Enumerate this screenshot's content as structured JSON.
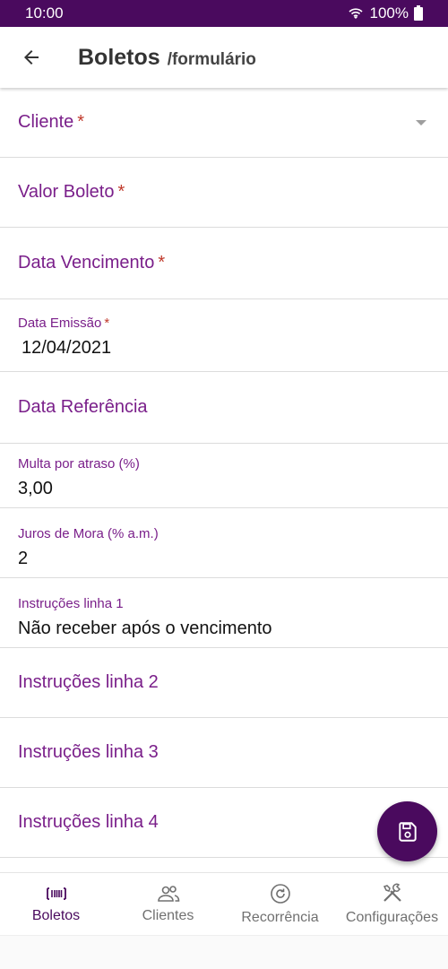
{
  "status": {
    "time": "10:00",
    "battery": "100%"
  },
  "appbar": {
    "title": "Boletos",
    "subtitle": "/formulário"
  },
  "fields": {
    "cliente": {
      "label": "Cliente",
      "req": "*"
    },
    "valor": {
      "label": "Valor Boleto",
      "req": "*"
    },
    "vencimento": {
      "label": "Data Vencimento",
      "req": "*"
    },
    "emissao": {
      "label": "Data Emissão",
      "req": "*",
      "value": "12/04/2021"
    },
    "referencia": {
      "label": "Data Referência"
    },
    "multa": {
      "label": "Multa por atraso (%)",
      "value": "3,00"
    },
    "juros": {
      "label": "Juros de Mora (% a.m.)",
      "value": "2"
    },
    "instr1": {
      "label": "Instruções linha 1",
      "value": "Não receber após o vencimento"
    },
    "instr2": {
      "label": "Instruções linha 2"
    },
    "instr3": {
      "label": "Instruções linha 3"
    },
    "instr4": {
      "label": "Instruções linha 4"
    }
  },
  "nav": {
    "items": [
      {
        "label": "Boletos",
        "icon": "barcode-icon",
        "active": true
      },
      {
        "label": "Clientes",
        "icon": "users-icon"
      },
      {
        "label": "Recorrência",
        "icon": "recurrence-icon"
      },
      {
        "label": "Configurações",
        "icon": "tools-icon"
      }
    ]
  },
  "colors": {
    "primary": "#4a0a5e",
    "label": "#7a1f8a",
    "required": "#c0392b"
  }
}
